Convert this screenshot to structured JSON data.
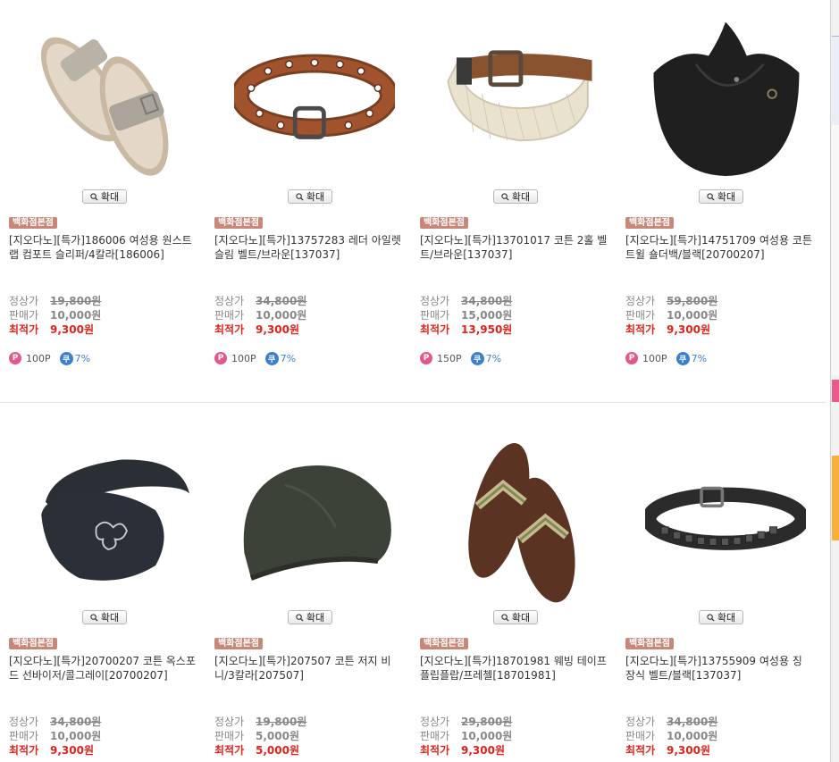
{
  "zoom_label": "확대",
  "badge_label": "백화점본점",
  "labels": {
    "regular": "정상가",
    "sale": "판매가",
    "best": "최적가"
  },
  "products": [
    {
      "title": "[지오다노][특가]186006 여성용 원스트랩 컴포트 슬리퍼/4칼라[186006]",
      "regular": "19,800원",
      "sale": "10,000원",
      "best": "9,300원",
      "points": "100P",
      "coupon": "7%",
      "image_icon": "sandal-icon"
    },
    {
      "title": "[지오다노][특가]13757283 레더 아일렛 슬림 벨트/브라운[137037]",
      "regular": "34,800원",
      "sale": "10,000원",
      "best": "9,300원",
      "points": "100P",
      "coupon": "7%",
      "image_icon": "belt-icon"
    },
    {
      "title": "[지오다노][특가]13701017 코튼 2홀 벨트/브라운[137037]",
      "regular": "34,800원",
      "sale": "15,000원",
      "best": "13,950원",
      "points": "150P",
      "coupon": "7%",
      "image_icon": "woven-belt-icon"
    },
    {
      "title": "[지오다노][특가]14751709 여성용 코튼 트윌 숄더백/블랙[20700207]",
      "regular": "59,800원",
      "sale": "10,000원",
      "best": "9,300원",
      "points": "100P",
      "coupon": "7%",
      "image_icon": "bag-icon"
    },
    {
      "title": "[지오다노][특가]20700207 코튼 옥스포드 선바이저/콜그레이[20700207]",
      "regular": "34,800원",
      "sale": "10,000원",
      "best": "9,300원",
      "image_icon": "visor-icon"
    },
    {
      "title": "[지오다노][특가]207507 코튼 저지 비니/3칼라[207507]",
      "regular": "19,800원",
      "sale": "5,000원",
      "best": "5,000원",
      "image_icon": "beanie-icon"
    },
    {
      "title": "[지오다노][특가]18701981 웨빙 테이프 플립플랍/프레첼[18701981]",
      "regular": "29,800원",
      "sale": "10,000원",
      "best": "9,300원",
      "image_icon": "flipflop-icon"
    },
    {
      "title": "[지오다노][특가]13755909 여성용 징 장식 벨트/블랙[137037]",
      "regular": "34,800원",
      "sale": "10,000원",
      "best": "9,300원",
      "image_icon": "studded-belt-icon"
    }
  ],
  "colors": {
    "best_price": "#e2231a",
    "badge": "#c9877a",
    "points": "#e0588e",
    "coupon": "#3b7fd1"
  }
}
